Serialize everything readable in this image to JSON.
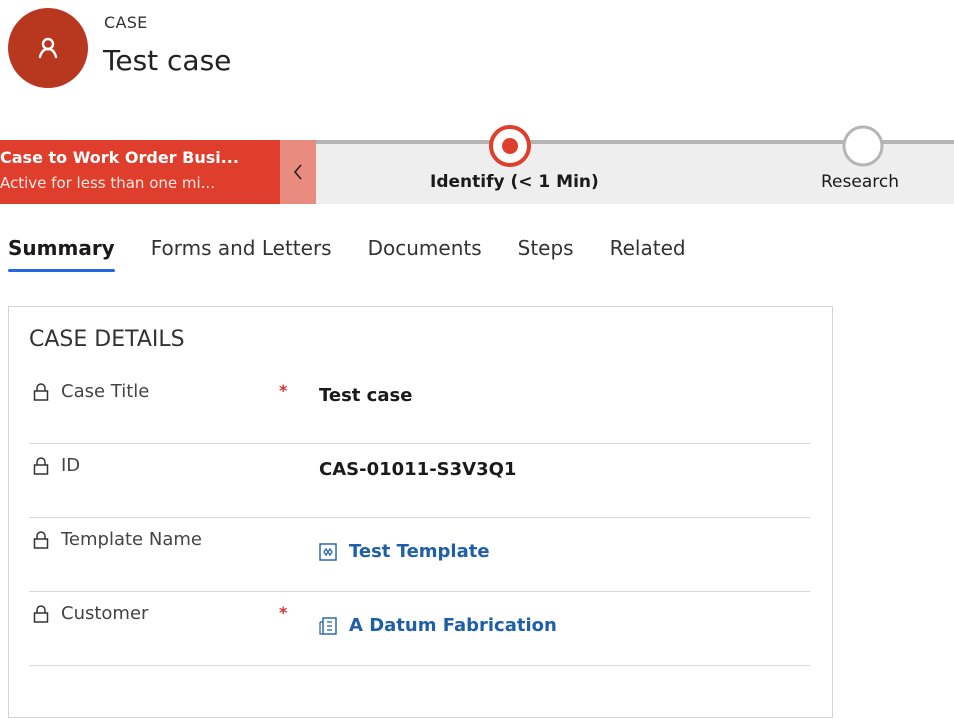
{
  "header": {
    "entity_type": "CASE",
    "title": "Test case",
    "avatar_icon": "user-icon",
    "avatar_color": "#b8381f"
  },
  "bpf": {
    "process_name": "Case to Work Order Busi...",
    "process_status": "Active for less than one mi...",
    "process_color": "#e03e2d",
    "stages": [
      {
        "label": "Identify  (< 1 Min)",
        "state": "active"
      },
      {
        "label": "Research",
        "state": "inactive"
      }
    ]
  },
  "tabs": [
    {
      "label": "Summary",
      "active": true
    },
    {
      "label": "Forms and Letters",
      "active": false
    },
    {
      "label": "Documents",
      "active": false
    },
    {
      "label": "Steps",
      "active": false
    },
    {
      "label": "Related",
      "active": false
    }
  ],
  "section": {
    "title": "CASE DETAILS",
    "fields": [
      {
        "label": "Case Title",
        "required": true,
        "value": "Test case",
        "type": "text"
      },
      {
        "label": "ID",
        "required": false,
        "value": "CAS-01011-S3V3Q1",
        "type": "text"
      },
      {
        "label": "Template Name",
        "required": false,
        "value": "Test Template",
        "type": "lookup",
        "icon": "template-icon"
      },
      {
        "label": "Customer",
        "required": true,
        "value": "A Datum Fabrication",
        "type": "lookup",
        "icon": "account-icon"
      }
    ],
    "required_marker": "*",
    "link_color": "#1f5fa8"
  }
}
